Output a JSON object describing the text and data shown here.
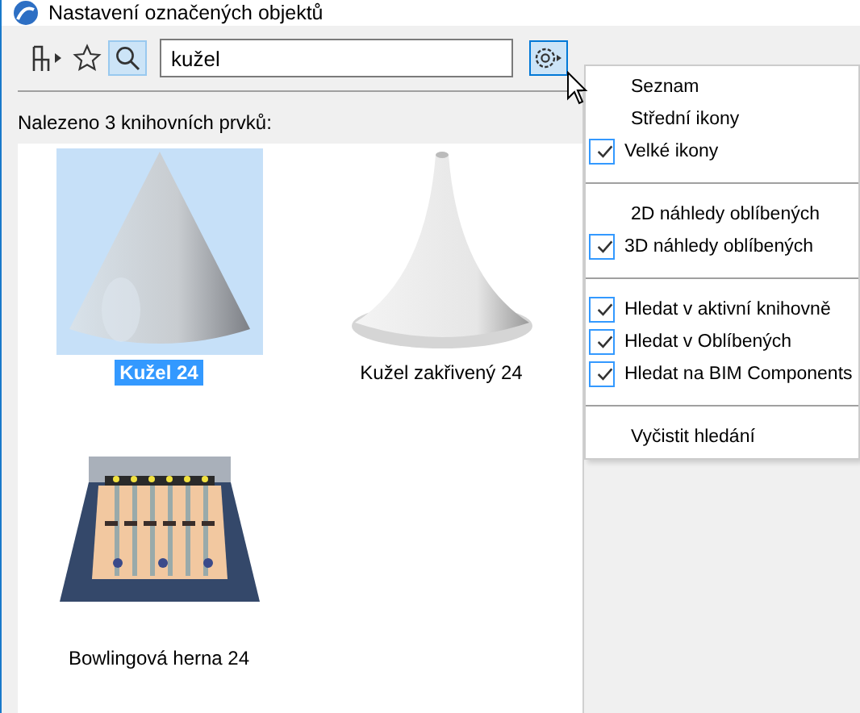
{
  "window": {
    "title": "Nastavení označených objektů"
  },
  "toolbar": {
    "search_toggle": {
      "selected": true
    },
    "search": {
      "value": "kužel"
    },
    "options": {
      "selected": true
    }
  },
  "result_count": "Nalezeno 3 knihovních prvků:",
  "items": [
    {
      "label": "Kužel 24",
      "selected": true
    },
    {
      "label": "Kužel zakřivený 24",
      "selected": false
    },
    {
      "label": "Bowlingová herna 24",
      "selected": false
    }
  ],
  "menu": {
    "groups": [
      [
        {
          "kind": "check",
          "label": "Seznam",
          "checked": false
        },
        {
          "kind": "check",
          "label": "Střední ikony",
          "checked": false
        },
        {
          "kind": "check",
          "label": "Velké ikony",
          "checked": true
        }
      ],
      [
        {
          "kind": "check",
          "label": "2D náhledy oblíbených",
          "checked": false
        },
        {
          "kind": "check",
          "label": "3D náhledy oblíbených",
          "checked": true
        }
      ],
      [
        {
          "kind": "check",
          "label": "Hledat v aktivní knihovně",
          "checked": true
        },
        {
          "kind": "check",
          "label": "Hledat v Oblíbených",
          "checked": true
        },
        {
          "kind": "check",
          "label": "Hledat na BIM Components",
          "checked": true
        }
      ],
      [
        {
          "kind": "action",
          "label": "Vyčistit hledání"
        }
      ]
    ]
  }
}
